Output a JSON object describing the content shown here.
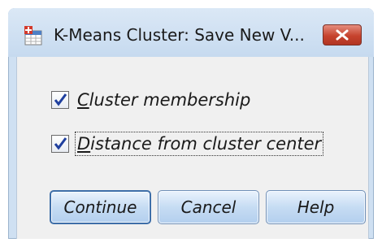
{
  "window": {
    "title": "K-Means Cluster: Save New V...",
    "app_icon": "spss-table-icon",
    "close_icon": "close-icon"
  },
  "options": [
    {
      "label_first": "C",
      "label_rest": "luster membership",
      "checked": true
    },
    {
      "label_first": "D",
      "label_rest": "istance from cluster center",
      "checked": true
    }
  ],
  "buttons": {
    "continue": "Continue",
    "cancel": "Cancel",
    "help": "Help"
  },
  "colors": {
    "titlebar": "#c6daef",
    "close": "#c6432e",
    "button": "#c6dcf3"
  }
}
